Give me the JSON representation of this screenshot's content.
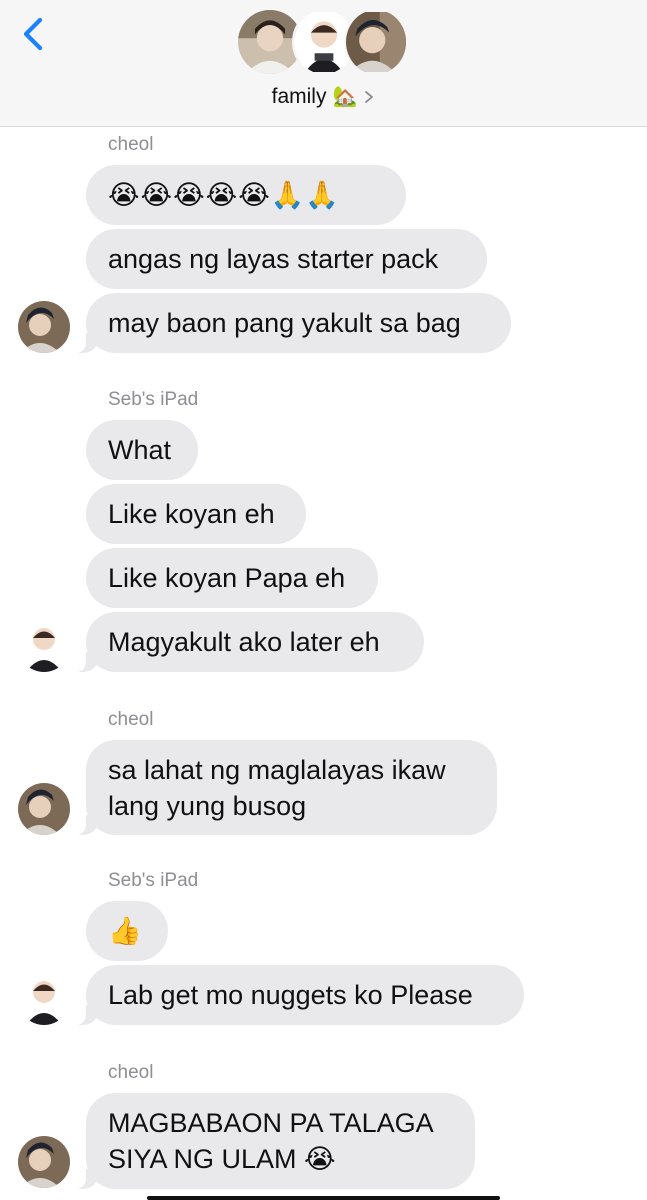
{
  "header": {
    "group_name": "family",
    "group_emoji": "🏡",
    "back_icon": "chevron-left-icon",
    "detail_icon": "chevron-right-icon",
    "accent_color": "#1a82fb"
  },
  "messages": [
    {
      "sender": "cheol"
    },
    {
      "text": "😭😭😭😭😭🙏🙏"
    },
    {
      "text": "angas ng layas starter pack"
    },
    {
      "text": "may baon pang yakult sa bag"
    },
    {
      "sender": "Seb's iPad"
    },
    {
      "text": "What"
    },
    {
      "text": "Like koyan eh"
    },
    {
      "text": "Like koyan Papa eh"
    },
    {
      "text": "Magyakult ako later eh"
    },
    {
      "sender": "cheol"
    },
    {
      "line1": "sa lahat ng maglalayas ikaw",
      "line2": "lang yung busog"
    },
    {
      "sender": "Seb's iPad"
    },
    {
      "text": "👍"
    },
    {
      "text": "Lab get mo nuggets ko Please"
    },
    {
      "sender": "cheol"
    },
    {
      "line1": "MAGBABAON PA TALAGA",
      "line2": "SIYA NG ULAM 😭"
    }
  ],
  "colors": {
    "bubble_bg": "#e9e9eb",
    "sender_label": "#8e8e93",
    "header_bg": "#f6f6f7"
  }
}
